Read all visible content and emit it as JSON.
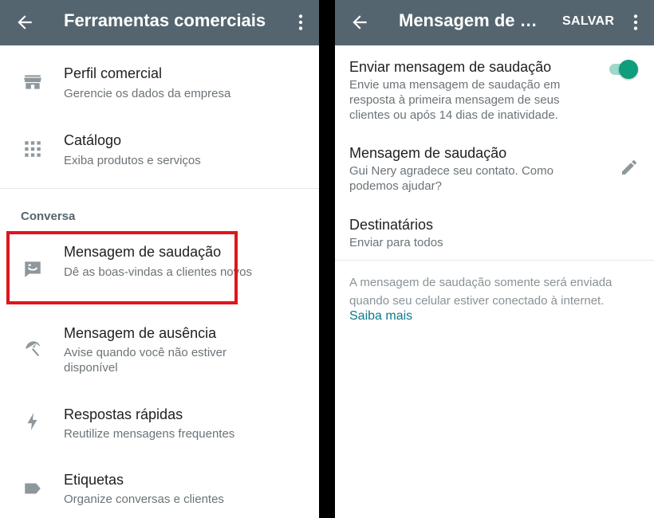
{
  "left": {
    "appbar": {
      "title": "Ferramentas comerciais"
    },
    "items": [
      {
        "title": "Perfil comercial",
        "subtitle": "Gerencie os dados da empresa"
      },
      {
        "title": "Catálogo",
        "subtitle": "Exiba produtos e serviços"
      }
    ],
    "section_label": "Conversa",
    "conversa_items": [
      {
        "title": "Mensagem de saudação",
        "subtitle": "Dê as boas-vindas a clientes novos"
      },
      {
        "title": "Mensagem de ausência",
        "subtitle": "Avise quando você não estiver disponível"
      },
      {
        "title": "Respostas rápidas",
        "subtitle": "Reutilize mensagens frequentes"
      },
      {
        "title": "Etiquetas",
        "subtitle": "Organize conversas e clientes"
      }
    ]
  },
  "right": {
    "appbar": {
      "title": "Mensagem de saudação",
      "save_label": "SALVAR"
    },
    "send_greeting": {
      "title": "Enviar mensagem de saudação",
      "description": "Envie uma mensagem de saudação em resposta à primeira mensagem de seus clientes ou após 14 dias de inatividade.",
      "enabled": true
    },
    "greeting_message": {
      "title": "Mensagem de saudação",
      "value": "Gui Nery agradece seu contato. Como podemos ajudar?"
    },
    "recipients": {
      "title": "Destinatários",
      "value": "Enviar para todos"
    },
    "footnote": "A mensagem de saudação somente será enviada quando seu celular estiver conectado à internet.",
    "learn_more": "Saiba mais"
  },
  "colors": {
    "appbar": "#54656f",
    "accent": "#0f9d7c",
    "link": "#0b7a8c",
    "highlight": "#e0141c"
  }
}
